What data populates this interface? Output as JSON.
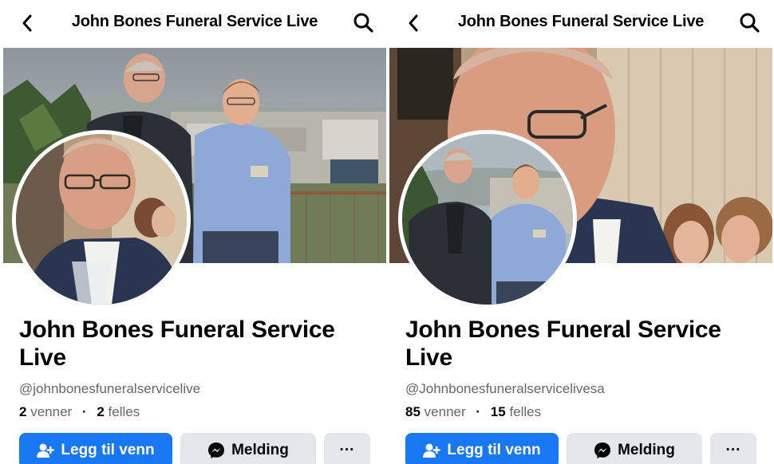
{
  "panels": [
    {
      "header": {
        "title": "John Bones Funeral Service Live"
      },
      "profile": {
        "name": "John Bones Funeral Service Live",
        "handle": "@johnbonesfuneralservicelive",
        "friends_count": "2",
        "friends_label": "venner",
        "mutual_count": "2",
        "mutual_label": "felles"
      },
      "actions": {
        "add_friend": "Legg til venn",
        "message": "Melding",
        "more": "···"
      }
    },
    {
      "header": {
        "title": "John Bones Funeral Service Live"
      },
      "profile": {
        "name": "John Bones Funeral Service Live",
        "handle": "@Johnbonesfuneralservicelivesa",
        "friends_count": "85",
        "friends_label": "venner",
        "mutual_count": "15",
        "mutual_label": "felles"
      },
      "actions": {
        "add_friend": "Legg til venn",
        "message": "Melding",
        "more": "···"
      }
    }
  ],
  "colors": {
    "primary": "#1877f2",
    "secondary_button": "#e4e6eb",
    "muted_text": "#65676b"
  },
  "icons": [
    "back-arrow-icon",
    "search-icon",
    "add-friend-icon",
    "messenger-icon",
    "more-icon"
  ]
}
